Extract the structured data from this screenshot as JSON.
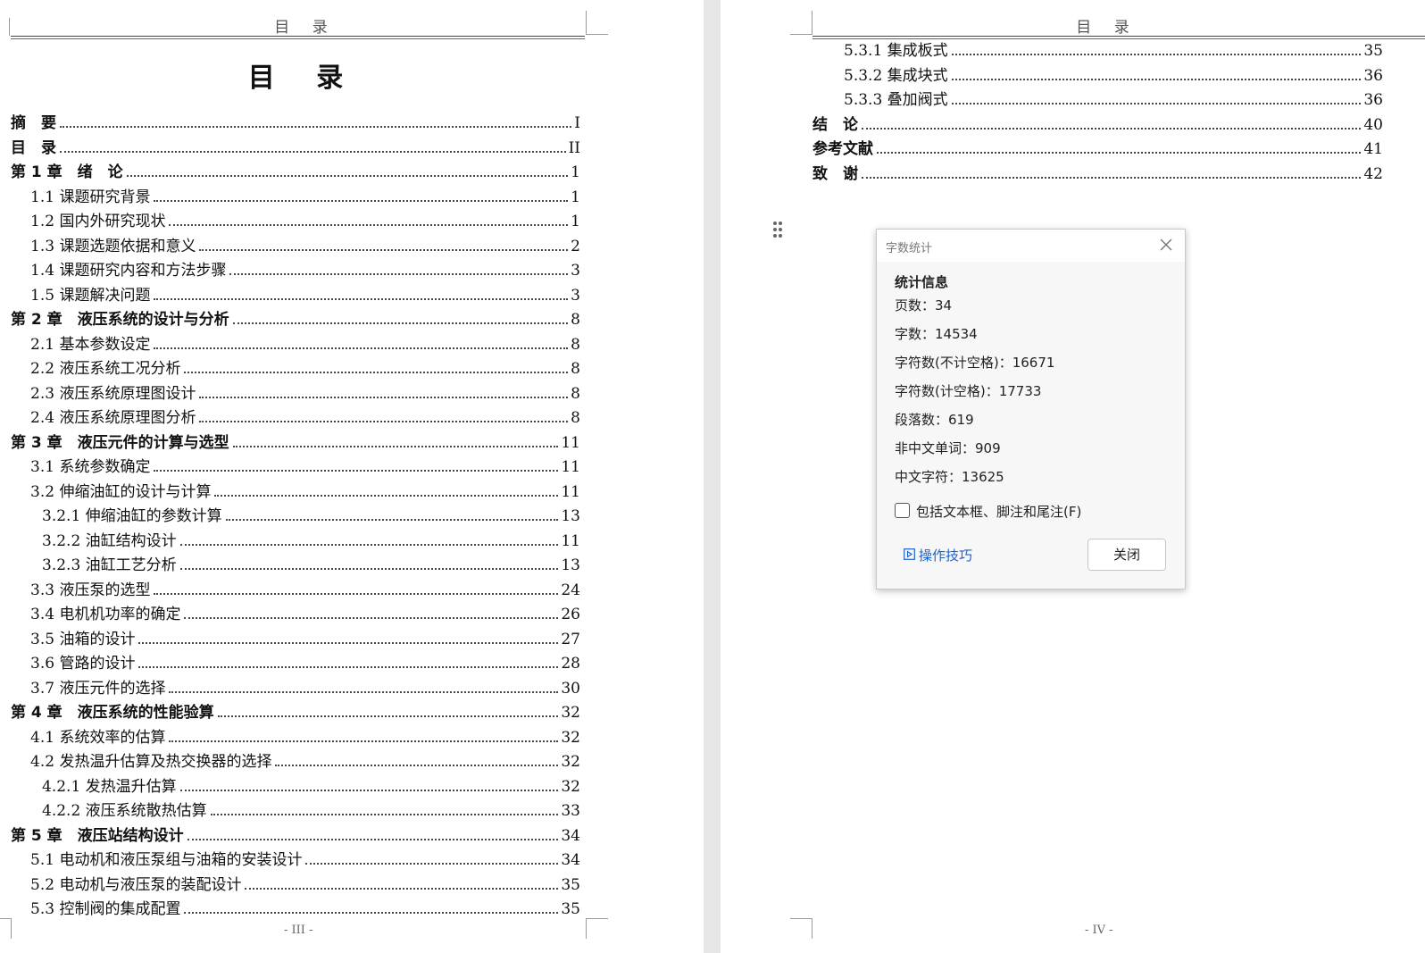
{
  "page_left": {
    "header": "目 录",
    "title": "目 录",
    "footer": "- III -",
    "toc": [
      {
        "label": "摘　要",
        "page": "I",
        "level": "ch"
      },
      {
        "label": "目　录",
        "page": "II",
        "level": "ch"
      },
      {
        "label": "第 1 章　绪　论",
        "page": "1",
        "level": "ch"
      },
      {
        "label": "1.1 课题研究背景",
        "page": "1",
        "level": "l1"
      },
      {
        "label": "1.2 国内外研究现状",
        "page": "1",
        "level": "l1"
      },
      {
        "label": "1.3 课题选题依据和意义",
        "page": "2",
        "level": "l1"
      },
      {
        "label": "1.4 课题研究内容和方法步骤",
        "page": "3",
        "level": "l1"
      },
      {
        "label": "1.5 课题解决问题",
        "page": "3",
        "level": "l1"
      },
      {
        "label": "第 2 章　液压系统的设计与分析",
        "page": "8",
        "level": "ch"
      },
      {
        "label": "2.1 基本参数设定",
        "page": "8",
        "level": "l1"
      },
      {
        "label": "2.2 液压系统工况分析",
        "page": "8",
        "level": "l1"
      },
      {
        "label": "2.3 液压系统原理图设计",
        "page": "8",
        "level": "l1"
      },
      {
        "label": "2.4 液压系统原理图分析",
        "page": "8",
        "level": "l1"
      },
      {
        "label": "第 3 章　液压元件的计算与选型",
        "page": "11",
        "level": "ch"
      },
      {
        "label": "3.1 系统参数确定",
        "page": "11",
        "level": "l1"
      },
      {
        "label": "3.2 伸缩油缸的设计与计算",
        "page": "11",
        "level": "l1"
      },
      {
        "label": "3.2.1 伸缩油缸的参数计算",
        "page": "13",
        "level": "l2"
      },
      {
        "label": "3.2.2 油缸结构设计",
        "page": "11",
        "level": "l2"
      },
      {
        "label": "3.2.3 油缸工艺分析",
        "page": "13",
        "level": "l2"
      },
      {
        "label": "3.3 液压泵的选型",
        "page": "24",
        "level": "l1"
      },
      {
        "label": "3.4 电机机功率的确定",
        "page": "26",
        "level": "l1"
      },
      {
        "label": "3.5 油箱的设计",
        "page": "27",
        "level": "l1"
      },
      {
        "label": "3.6 管路的设计",
        "page": "28",
        "level": "l1"
      },
      {
        "label": "3.7 液压元件的选择",
        "page": "30",
        "level": "l1"
      },
      {
        "label": "第 4 章　液压系统的性能验算",
        "page": "32",
        "level": "ch"
      },
      {
        "label": "4.1 系统效率的估算",
        "page": "32",
        "level": "l1"
      },
      {
        "label": "4.2 发热温升估算及热交换器的选择",
        "page": "32",
        "level": "l1"
      },
      {
        "label": "4.2.1 发热温升估算",
        "page": "32",
        "level": "l2"
      },
      {
        "label": "4.2.2 液压系统散热估算",
        "page": "33",
        "level": "l2"
      },
      {
        "label": "第 5 章　液压站结构设计",
        "page": "34",
        "level": "ch"
      },
      {
        "label": "5.1 电动机和液压泵组与油箱的安装设计",
        "page": "34",
        "level": "l1"
      },
      {
        "label": "5.2 电动机与液压泵的装配设计",
        "page": "35",
        "level": "l1"
      },
      {
        "label": "5.3 控制阀的集成配置",
        "page": "35",
        "level": "l1"
      }
    ]
  },
  "page_right": {
    "header": "目 录",
    "footer": "- IV -",
    "toc": [
      {
        "label": "5.3.1 集成板式",
        "page": "35",
        "level": "l2"
      },
      {
        "label": "5.3.2 集成块式",
        "page": "36",
        "level": "l2"
      },
      {
        "label": "5.3.3 叠加阀式",
        "page": "36",
        "level": "l2"
      },
      {
        "label": "结　论",
        "page": "40",
        "level": "ch"
      },
      {
        "label": "参考文献",
        "page": "41",
        "level": "ch"
      },
      {
        "label": "致　谢",
        "page": "42",
        "level": "ch"
      }
    ]
  },
  "dialog": {
    "title": "字数统计",
    "section": "统计信息",
    "stats": [
      "页数：34",
      "字数：14534",
      "字符数(不计空格)：16671",
      "字符数(计空格)：17733",
      "段落数：619",
      "非中文单词：909",
      "中文字符：13625"
    ],
    "checkbox_label": "包括文本框、脚注和尾注(F)",
    "checkbox_checked": false,
    "tips_label": "操作技巧",
    "close_label": "关闭",
    "link_color": "#1d5fd1"
  }
}
